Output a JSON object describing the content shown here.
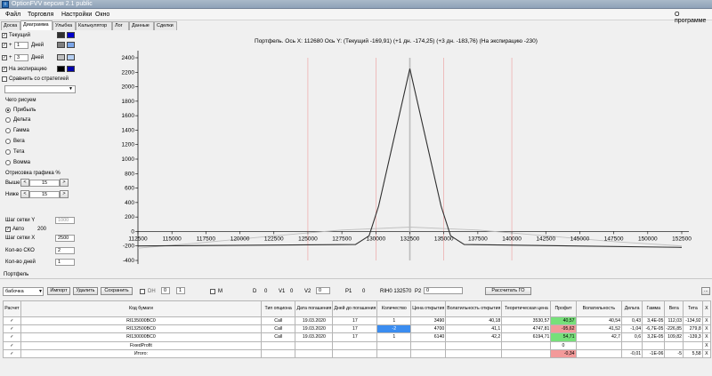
{
  "window": {
    "title": "OptionFVV версия 2.1 public"
  },
  "menu": {
    "items": [
      "Файл",
      "Торговля",
      "Настройки",
      "Окно"
    ],
    "right": "О программе"
  },
  "tabs": [
    "Доска",
    "Диаграмма",
    "Улыбка",
    "Калькулятор",
    "Лог",
    "Данные",
    "Сделки"
  ],
  "active_tab": "Диаграмма",
  "left": {
    "current": {
      "label": "Текущий",
      "c1": "#2f2f2f",
      "c2": "#0000cc"
    },
    "plus1": {
      "sign": "+",
      "value": "1",
      "unit": "Дней",
      "c1": "#7f7f7f",
      "c2": "#7ba6e8"
    },
    "plus3": {
      "sign": "+",
      "value": "3",
      "unit": "Дней",
      "c1": "#bfbfbf",
      "c2": "#b6cff2"
    },
    "expiry": {
      "label": "На экспирацию",
      "c1": "#000000",
      "c2": "#0000aa"
    },
    "compare": "Сравнить со стратегией",
    "draw_title": "Чего рисуем",
    "draw_options": [
      "Прибыль",
      "Дельта",
      "Гамма",
      "Вега",
      "Тета",
      "Вомма"
    ],
    "render_title": "Отрисовка графика %",
    "above_label": "Выше",
    "above_value": "15",
    "below_label": "Ниже",
    "below_value": "15",
    "step_y_label": "Шаг сетки Y",
    "step_y_value": "1000",
    "auto_label": "Авто",
    "auto_value": "200",
    "step_x_label": "Шаг сетки X",
    "step_x_value": "2500",
    "sko_label": "Кол-во СКО",
    "sko_value": "2",
    "days_label": "Кол-во дней",
    "days_value": "1"
  },
  "chart_data": {
    "type": "line",
    "title": "Портфель. Ось X:  112680 Ось Y:   (Текущий -169,91)   (+1 дн. -174,25)   (+3 дн. -183,76)   (На экспирацию -230)",
    "xlim": [
      112500,
      152500
    ],
    "ylim": [
      -400,
      2400
    ],
    "xticks": [
      112500,
      115000,
      117500,
      120000,
      122500,
      125000,
      127500,
      130000,
      132500,
      135000,
      137500,
      140000,
      142500,
      145000,
      147500,
      150000,
      152500
    ],
    "yticks": [
      -400,
      -200,
      0,
      200,
      400,
      600,
      800,
      1000,
      1200,
      1400,
      1600,
      1800,
      2000,
      2200,
      2400
    ],
    "vlines": [
      125000,
      130000,
      132500,
      135000,
      140000
    ],
    "series": [
      {
        "color": "#2f2f2f",
        "points": [
          [
            112500,
            -200
          ],
          [
            128500,
            -180
          ],
          [
            129500,
            -60
          ],
          [
            130200,
            350
          ],
          [
            132500,
            2250
          ],
          [
            134800,
            350
          ],
          [
            135500,
            -60
          ],
          [
            136500,
            -180
          ],
          [
            152500,
            -220
          ]
        ]
      },
      {
        "color": "#bfbfbf",
        "points": [
          [
            112500,
            -230
          ],
          [
            117500,
            -150
          ],
          [
            122500,
            -60
          ],
          [
            127500,
            20
          ],
          [
            132500,
            60
          ],
          [
            137500,
            20
          ],
          [
            142500,
            -60
          ],
          [
            147500,
            -140
          ],
          [
            152500,
            -200
          ]
        ]
      }
    ]
  },
  "portfolio": {
    "label": "Портфель",
    "name": "бабочка",
    "import": "Импорт",
    "delete": "Удалить",
    "save": "Сохранить",
    "dh_label": "DH",
    "dh1": "0",
    "dh2": "1",
    "m_label": "M",
    "d_label": "D",
    "d_value": "0",
    "v1_label": "V1",
    "v1_value": "0",
    "v2_label": "V2",
    "v2_value": "0",
    "p1_label": "P1",
    "p1_value": "0",
    "code": "RIH0 132570",
    "p2_label": "P2",
    "p2_value": "0",
    "calc": "Рассчитать ГО",
    "dots": "..."
  },
  "table": {
    "headers": [
      "Расчет",
      "Код бумаги",
      "Тип опциона",
      "Дата погашения",
      "Дней до погашения",
      "Количество",
      "Цена открытия",
      "Волатильность открытия",
      "Теоретическая цена",
      "Профит",
      "Волатильность",
      "Дельта",
      "Гамма",
      "Вега",
      "Тета",
      "X"
    ],
    "rows": [
      [
        "✓",
        "RI135000BC0",
        "Call",
        "19.03.2020",
        "17",
        "1",
        "3490",
        "40,18",
        "3530,57",
        "40,57",
        "40,54",
        "0,43",
        "3,4E-05",
        "112,03",
        "-134,92",
        "X"
      ],
      [
        "✓",
        "RI132500BC0",
        "Call",
        "19.03.2020",
        "17",
        "-2",
        "4700",
        "41,1",
        "4747,81",
        "-95,62",
        "41,52",
        "-1,04",
        "-6,7E-05",
        "-226,85",
        "279,8",
        "X"
      ],
      [
        "✓",
        "RI130000BC0",
        "Call",
        "19.03.2020",
        "17",
        "1",
        "6140",
        "42,2",
        "6194,71",
        "54,71",
        "42,7",
        "0,6",
        "3,2E-05",
        "109,82",
        "-139,3",
        "X"
      ],
      [
        "✓",
        "FixedProfit",
        "",
        "",
        "",
        "",
        "",
        "",
        "",
        "0",
        "",
        "",
        "",
        "",
        "",
        "X"
      ],
      [
        "✓",
        "Итого:",
        "",
        "",
        "",
        "",
        "",
        "",
        "",
        "-0,34",
        "",
        "-0,01",
        "-1E-06",
        "-5",
        "5,58",
        "X"
      ]
    ]
  }
}
